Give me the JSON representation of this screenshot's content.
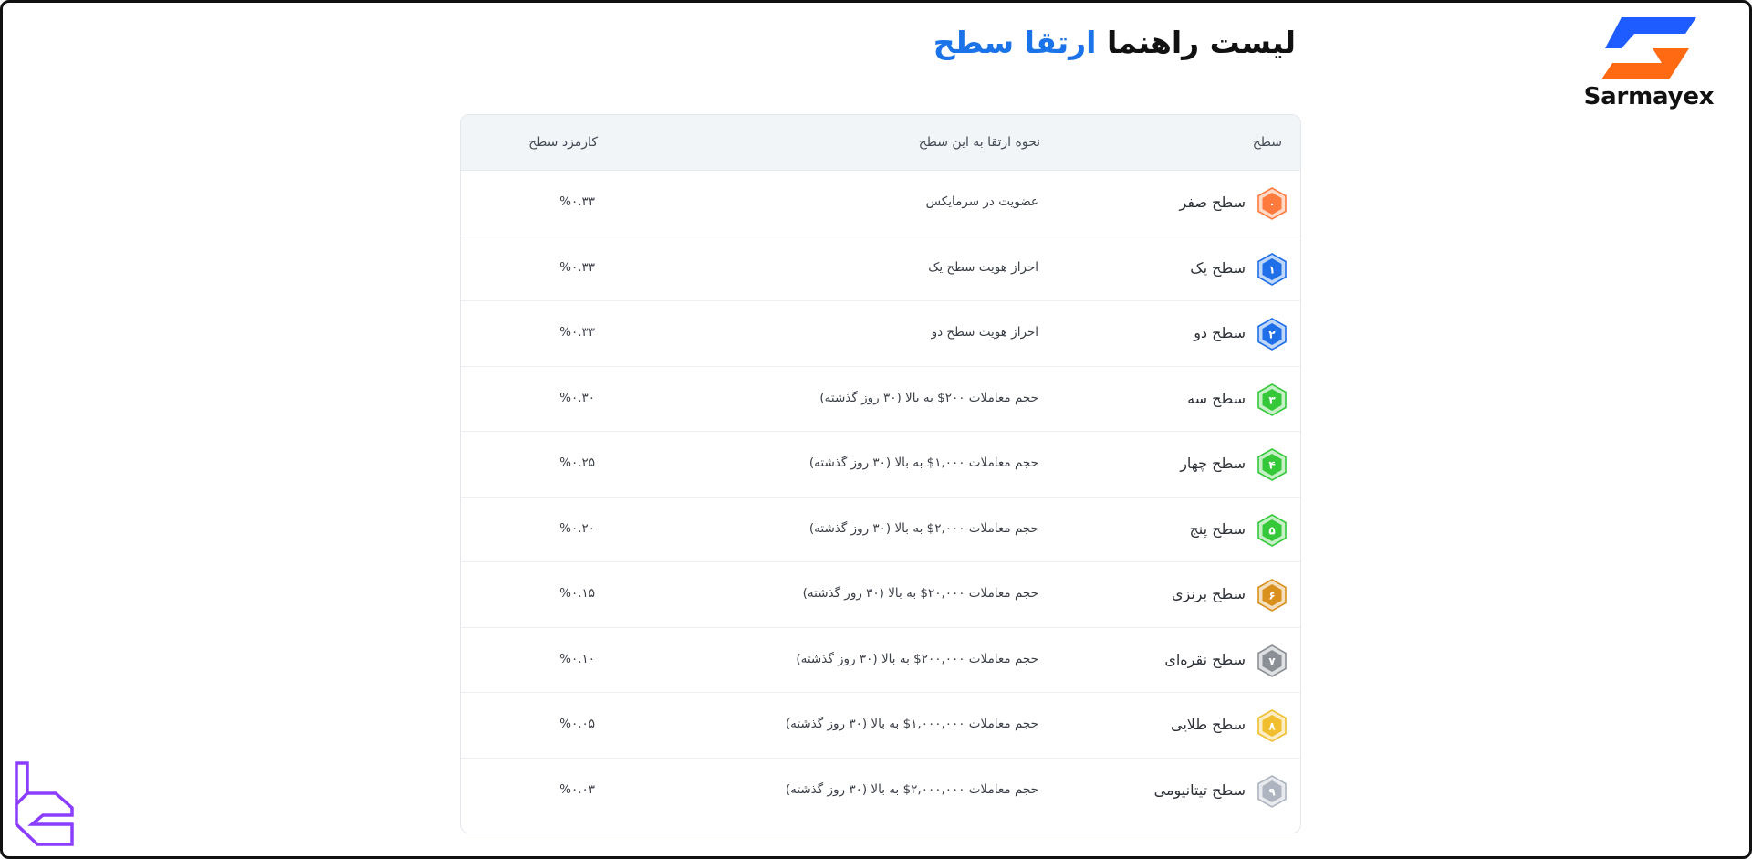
{
  "brand": {
    "name": "Sarmayex",
    "colors": {
      "blue": "#1e5cff",
      "orange": "#ff6a13"
    }
  },
  "corner_logo": {
    "color": "#8b3dff"
  },
  "title": {
    "part1": "لیست راهنما",
    "part2": "ارتقا سطح"
  },
  "table": {
    "headers": {
      "level": "سطح",
      "method": "نحوه ارتقا به این سطح",
      "fee": "کارمزد سطح"
    },
    "rows": [
      {
        "badge": "۰",
        "badge_color": "#ff7a3d",
        "level": "سطح صفر",
        "method": "عضویت در سرمایکس",
        "fee": "%۰.۳۳"
      },
      {
        "badge": "۱",
        "badge_color": "#1e6fe8",
        "level": "سطح یک",
        "method": "احراز هویت سطح یک",
        "fee": "%۰.۳۳"
      },
      {
        "badge": "۲",
        "badge_color": "#1e6fe8",
        "level": "سطح دو",
        "method": "احراز هویت سطح دو",
        "fee": "%۰.۳۳"
      },
      {
        "badge": "۳",
        "badge_color": "#35c93a",
        "level": "سطح سه",
        "method": "حجم معاملات ۲۰۰$ به بالا (۳۰ روز گذشته)",
        "fee": "%۰.۳۰"
      },
      {
        "badge": "۴",
        "badge_color": "#35c93a",
        "level": "سطح چهار",
        "method": "حجم معاملات ۱,۰۰۰$ به بالا (۳۰ روز گذشته)",
        "fee": "%۰.۲۵"
      },
      {
        "badge": "۵",
        "badge_color": "#35c93a",
        "level": "سطح پنج",
        "method": "حجم معاملات ۲,۰۰۰$ به بالا (۳۰ روز گذشته)",
        "fee": "%۰.۲۰"
      },
      {
        "badge": "۶",
        "badge_color": "#d9901c",
        "level": "سطح برنزی",
        "method": "حجم معاملات ۲۰,۰۰۰$ به بالا (۳۰ روز گذشته)",
        "fee": "%۰.۱۵"
      },
      {
        "badge": "۷",
        "badge_color": "#8a8f96",
        "level": "سطح نقره‌ای",
        "method": "حجم معاملات ۲۰۰,۰۰۰$ به بالا (۳۰ روز گذشته)",
        "fee": "%۰.۱۰"
      },
      {
        "badge": "۸",
        "badge_color": "#f0be2e",
        "level": "سطح طلایی",
        "method": "حجم معاملات ۱,۰۰۰,۰۰۰$ به بالا (۳۰ روز گذشته)",
        "fee": "%۰.۰۵"
      },
      {
        "badge": "۹",
        "badge_color": "#aeb5c0",
        "level": "سطح تیتانیومی",
        "method": "حجم معاملات ۲,۰۰۰,۰۰۰$ به بالا (۳۰ روز گذشته)",
        "fee": "%۰.۰۳"
      }
    ]
  }
}
